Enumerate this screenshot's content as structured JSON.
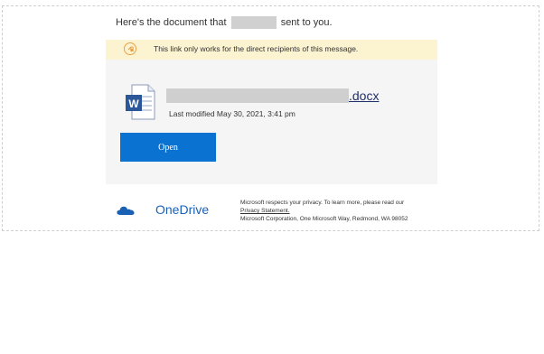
{
  "intro": {
    "before": "Here's the document that",
    "after": "sent to you."
  },
  "banner": {
    "text": "This link only works for the direct recipients of this message.",
    "icon": "link-lock-icon",
    "background": "#fcf3d0"
  },
  "file": {
    "extension": ".docx",
    "modified": "Last modified May 30, 2021, 3:41 pm",
    "icon": "word-document-icon"
  },
  "open_button": {
    "label": "Open",
    "color": "#0a72d1"
  },
  "footer": {
    "brand": "OneDrive",
    "brand_color": "#1a61b5",
    "privacy_line": "Microsoft respects your privacy. To learn more, please read our",
    "privacy_link": "Privacy Statement.",
    "address": "Microsoft Corporation, One Microsoft Way, Redmond, WA 98052"
  }
}
